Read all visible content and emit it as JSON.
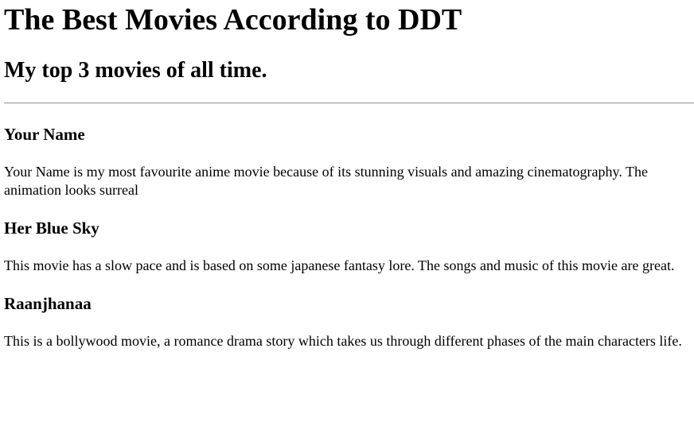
{
  "page": {
    "title": "The Best Movies According to DDT",
    "subtitle": "My top 3 movies of all time."
  },
  "movies": [
    {
      "name": "Your Name",
      "description": "Your Name is my most favourite anime movie because of its stunning visuals and amazing cinematography. The animation looks surreal"
    },
    {
      "name": "Her Blue Sky",
      "description": "This movie has a slow pace and is based on some japanese fantasy lore. The songs and music of this movie are great."
    },
    {
      "name": "Raanjhanaa",
      "description": "This is a bollywood movie, a romance drama story which takes us through different phases of the main characters life."
    }
  ]
}
